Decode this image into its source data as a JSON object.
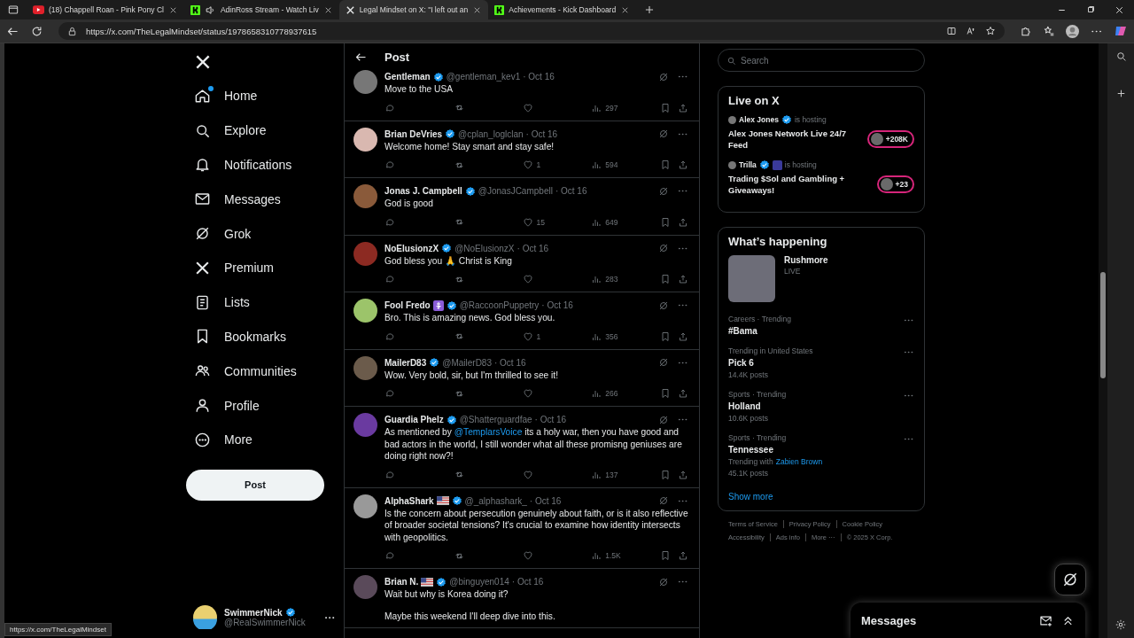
{
  "browser": {
    "tabs": [
      {
        "title": "(18) Chappell Roan - Pink Pony Cl",
        "kind": "youtube",
        "audio": false,
        "selected": false
      },
      {
        "title": "AdinRoss Stream - Watch Liv",
        "kind": "kick",
        "audio": true,
        "selected": false
      },
      {
        "title": "Legal Mindset on X: \"I left out an",
        "kind": "x",
        "audio": false,
        "selected": true
      },
      {
        "title": "Achievements - Kick Dashboard",
        "kind": "kick",
        "audio": false,
        "selected": false
      }
    ],
    "url": "https://x.com/TheLegalMindset/status/1978658310778937615",
    "status_url": "https://x.com/TheLegalMindset"
  },
  "nav": {
    "items": [
      {
        "label": "Home",
        "dot": true
      },
      {
        "label": "Explore",
        "dot": false
      },
      {
        "label": "Notifications",
        "dot": false
      },
      {
        "label": "Messages",
        "dot": false
      },
      {
        "label": "Grok",
        "dot": false
      },
      {
        "label": "Premium",
        "dot": false
      },
      {
        "label": "Lists",
        "dot": false
      },
      {
        "label": "Bookmarks",
        "dot": false
      },
      {
        "label": "Communities",
        "dot": false
      },
      {
        "label": "Profile",
        "dot": false
      },
      {
        "label": "More",
        "dot": false
      }
    ],
    "post_button": "Post",
    "account": {
      "name": "SwimmerNick",
      "handle": "@RealSwimmerNick"
    }
  },
  "feed": {
    "title": "Post",
    "replies": [
      {
        "name": "Gentleman",
        "flag": false,
        "extra_badge": false,
        "handle": "@gentleman_kev1",
        "date": "· Oct 16",
        "text": [
          "Move to the USA"
        ],
        "views": "297"
      },
      {
        "name": "Brian DeVries",
        "flag": false,
        "extra_badge": false,
        "handle": "@cplan_loglclan",
        "date": "· Oct 16",
        "text": [
          "Welcome home! Stay smart and stay safe!"
        ],
        "likes": "1",
        "views": "594"
      },
      {
        "name": "Jonas J. Campbell",
        "flag": false,
        "extra_badge": false,
        "handle": "@JonasJCampbell",
        "date": "· Oct 16",
        "text": [
          "God is good"
        ],
        "likes": "15",
        "views": "649"
      },
      {
        "name": "NoElusionzX",
        "flag": false,
        "extra_badge": false,
        "handle": "@NoElusionzX",
        "date": "· Oct 16",
        "text": [
          "God bless you 🙏 Christ is King"
        ],
        "views": "283"
      },
      {
        "name": "Fool Fredo",
        "flag": false,
        "extra_badge": true,
        "handle": "@RaccoonPuppetry",
        "date": "· Oct 16",
        "text": [
          "Bro. This is amazing news. God bless you."
        ],
        "likes": "1",
        "views": "356"
      },
      {
        "name": "MailerD83",
        "flag": false,
        "extra_badge": false,
        "handle": "@MailerD83",
        "date": "· Oct 16",
        "text": [
          "Wow. Very bold, sir, but I'm thrilled to see it!"
        ],
        "views": "266"
      },
      {
        "name": "Guardia Phelz",
        "flag": false,
        "extra_badge": false,
        "handle": "@Shatterguardfae",
        "date": "· Oct 16",
        "text": [
          "As mentioned by",
          "@TemplarsVoice",
          "its a holy war, then you have good and bad actors in the world, I still wonder what all these promisng geniuses are doing right now?!"
        ],
        "views": "137"
      },
      {
        "name": "AlphaShark",
        "flag": true,
        "extra_badge": false,
        "handle": "@_alphashark_",
        "date": "· Oct 16",
        "text": [
          "Is the concern about persecution genuinely about faith, or is it also reflective of broader societal tensions? It's crucial to examine how identity intersects with geopolitics."
        ],
        "views": "1.5K"
      },
      {
        "name": "Brian N.",
        "flag": true,
        "extra_badge": false,
        "handle": "@binguyen014",
        "date": "· Oct 16",
        "text": [
          "Wait but why is Korea doing it?",
          "Maybe this weekend I'll deep dive into this."
        ]
      }
    ]
  },
  "right": {
    "search_placeholder": "Search",
    "live": {
      "title": "Live on X",
      "items": [
        {
          "host": "Alex Jones",
          "extra_badge": false,
          "hosting": "is hosting",
          "title": "Alex Jones Network Live 24/7 Feed",
          "count": "+208K"
        },
        {
          "host": "Trilla",
          "extra_badge": true,
          "hosting": "is hosting",
          "title": "Trading $Sol and Gambling + Giveaways!",
          "count": "+23"
        }
      ]
    },
    "happening": {
      "title": "What’s happening",
      "featured": {
        "title": "Rushmore",
        "status": "LIVE"
      },
      "trends": [
        {
          "context": "Careers · Trending",
          "name": "#Bama"
        },
        {
          "context": "Trending in United States",
          "name": "Pick 6",
          "posts": "14.4K posts"
        },
        {
          "context": "Sports · Trending",
          "name": "Holland",
          "posts": "10.6K posts"
        },
        {
          "context": "Sports · Trending",
          "name": "Tennessee",
          "posts": "45.1K posts",
          "with_label": "Trending with",
          "with_link": "Zabien Brown"
        }
      ],
      "show_more": "Show more"
    },
    "footer": [
      [
        "Terms of Service",
        "Privacy Policy",
        "Cookie Policy"
      ],
      [
        "Accessibility",
        "Ads info",
        "More ···",
        "© 2025 X Corp."
      ]
    ]
  },
  "messages_drawer": {
    "title": "Messages"
  }
}
